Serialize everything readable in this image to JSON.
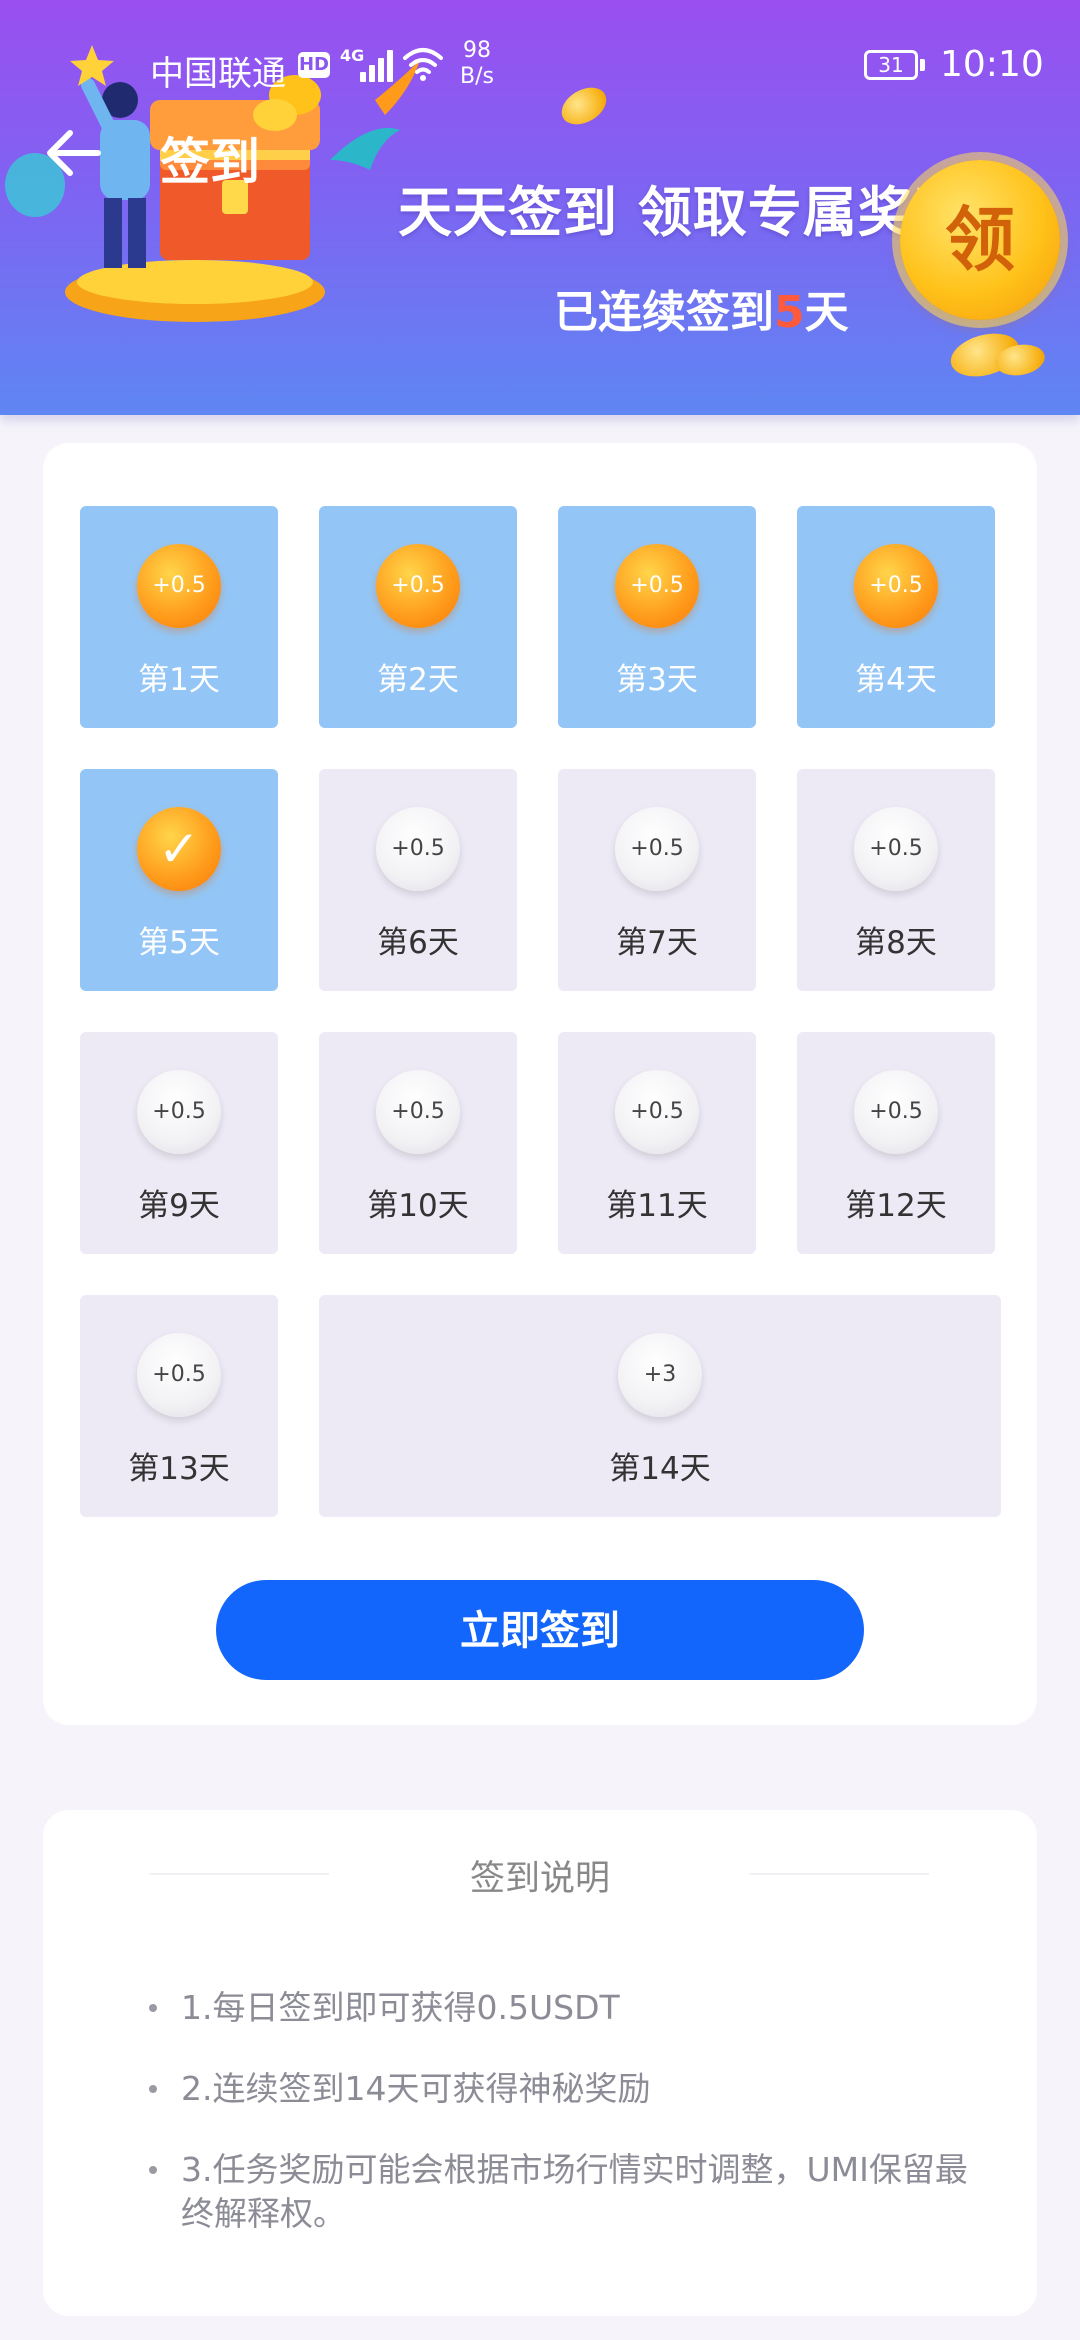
{
  "status_bar": {
    "carrier": "中国联通",
    "hd": "HD",
    "network": "4G",
    "speed_value": "98",
    "speed_unit": "B/s",
    "battery": "31",
    "time": "10:10"
  },
  "header": {
    "title": "签到",
    "headline": "天天签到 领取专属奖励",
    "streak_prefix": "已连续签到",
    "streak_days": "5",
    "streak_suffix": "天",
    "coin_text": "领"
  },
  "days": [
    {
      "label": "第1天",
      "reward": "+0.5",
      "state": "done"
    },
    {
      "label": "第2天",
      "reward": "+0.5",
      "state": "done"
    },
    {
      "label": "第3天",
      "reward": "+0.5",
      "state": "done"
    },
    {
      "label": "第4天",
      "reward": "+0.5",
      "state": "done"
    },
    {
      "label": "第5天",
      "reward": "",
      "state": "today-done"
    },
    {
      "label": "第6天",
      "reward": "+0.5",
      "state": "pending"
    },
    {
      "label": "第7天",
      "reward": "+0.5",
      "state": "pending"
    },
    {
      "label": "第8天",
      "reward": "+0.5",
      "state": "pending"
    },
    {
      "label": "第9天",
      "reward": "+0.5",
      "state": "pending"
    },
    {
      "label": "第10天",
      "reward": "+0.5",
      "state": "pending"
    },
    {
      "label": "第11天",
      "reward": "+0.5",
      "state": "pending"
    },
    {
      "label": "第12天",
      "reward": "+0.5",
      "state": "pending"
    },
    {
      "label": "第13天",
      "reward": "+0.5",
      "state": "pending"
    },
    {
      "label": "第14天",
      "reward": "+3",
      "state": "pending"
    }
  ],
  "signin_button": "立即签到",
  "rules": {
    "title": "签到说明",
    "items": [
      "1.每日签到即可获得0.5USDT",
      "2.连续签到14天可获得神秘奖励",
      "3.任务奖励可能会根据市场行情实时调整，UMI保留最终解释权。"
    ]
  },
  "colors": {
    "accent": "#1366fc",
    "done_tile": "#93c6f6",
    "pending_tile": "#edeaf6",
    "streak_number": "#ff5a3a"
  }
}
